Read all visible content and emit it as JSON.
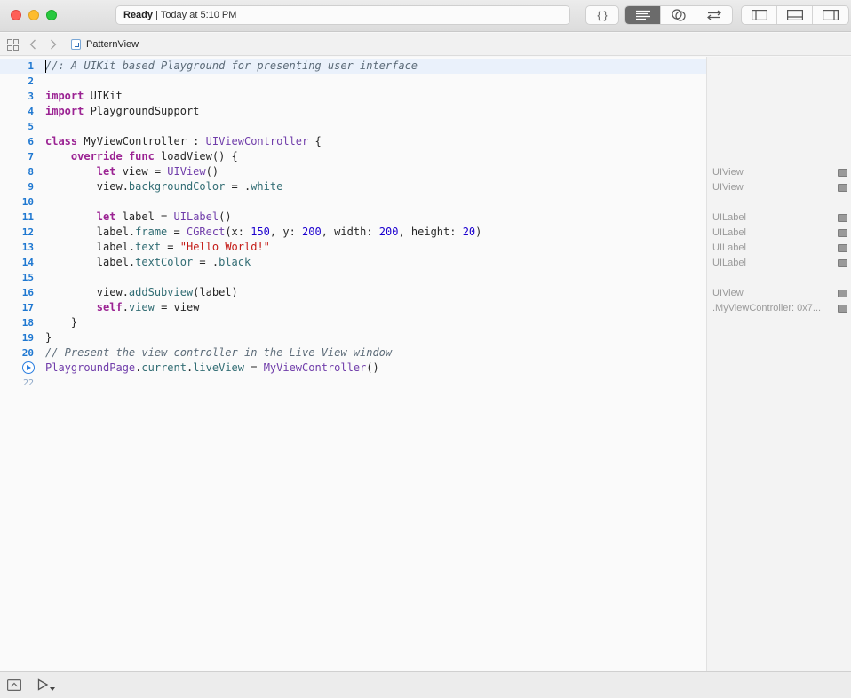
{
  "window": {
    "status_label": "Ready",
    "status_separator": "|",
    "status_time": "Today at 5:10 PM"
  },
  "toolbar": {
    "braces_label": "{ }"
  },
  "jumpbar": {
    "file_name": "PatternView"
  },
  "code": {
    "lines": [
      {
        "n": "1",
        "text": "//: A UIKit based Playground for presenting user interface"
      },
      {
        "n": "2",
        "text": ""
      },
      {
        "n": "3",
        "text": "import UIKit"
      },
      {
        "n": "4",
        "text": "import PlaygroundSupport"
      },
      {
        "n": "5",
        "text": ""
      },
      {
        "n": "6",
        "text": "class MyViewController : UIViewController {"
      },
      {
        "n": "7",
        "text": "    override func loadView() {"
      },
      {
        "n": "8",
        "text": "        let view = UIView()"
      },
      {
        "n": "9",
        "text": "        view.backgroundColor = .white"
      },
      {
        "n": "10",
        "text": ""
      },
      {
        "n": "11",
        "text": "        let label = UILabel()"
      },
      {
        "n": "12",
        "text": "        label.frame = CGRect(x: 150, y: 200, width: 200, height: 20)"
      },
      {
        "n": "13",
        "text": "        label.text = \"Hello World!\""
      },
      {
        "n": "14",
        "text": "        label.textColor = .black"
      },
      {
        "n": "15",
        "text": ""
      },
      {
        "n": "16",
        "text": "        view.addSubview(label)"
      },
      {
        "n": "17",
        "text": "        self.view = view"
      },
      {
        "n": "18",
        "text": "    }"
      },
      {
        "n": "19",
        "text": "}"
      },
      {
        "n": "20",
        "text": "// Present the view controller in the Live View window"
      },
      {
        "n": "",
        "text": "PlaygroundPage.current.liveView = MyViewController()"
      },
      {
        "n": "22",
        "text": ""
      }
    ]
  },
  "results": {
    "rows": [
      {
        "line": "8",
        "text": "UIView"
      },
      {
        "line": "9",
        "text": "UIView"
      },
      {
        "line": "11",
        "text": "UILabel"
      },
      {
        "line": "12",
        "text": "UILabel"
      },
      {
        "line": "13",
        "text": "UILabel"
      },
      {
        "line": "14",
        "text": "UILabel"
      },
      {
        "line": "16",
        "text": "UIView"
      },
      {
        "line": "17",
        "text": ".MyViewController: 0x7..."
      }
    ]
  },
  "colors": {
    "accent": "#1f78d1",
    "keyword": "#9b2393",
    "type": "#703daa",
    "property": "#326d74",
    "string": "#c41a16",
    "number": "#1c00cf",
    "comment": "#5d6c79"
  }
}
